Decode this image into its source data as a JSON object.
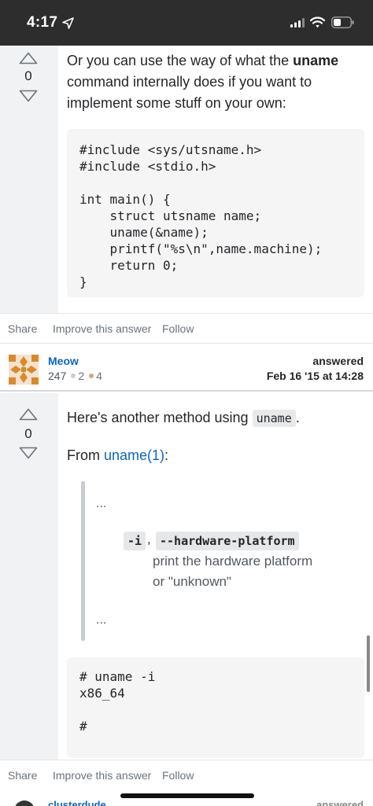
{
  "status_bar": {
    "time": "4:17"
  },
  "answer1": {
    "vote_count": "0",
    "text_before": "Or you can use the way of what the ",
    "text_bold": "uname",
    "text_after": " command internally does if you want to implement some stuff on your own:",
    "code": "#include <sys/utsname.h>\n#include <stdio.h>\n\nint main() {\n    struct utsname name;\n    uname(&name);\n    printf(\"%s\\n\",name.machine);\n    return 0;\n}",
    "actions": {
      "share": "Share",
      "improve": "Improve this answer",
      "follow": "Follow"
    },
    "author": {
      "name": "Meow",
      "reputation": "247",
      "silver_badges": "2",
      "bronze_badges": "4",
      "answered_label": "answered",
      "answered_date": "Feb 16 '15 at 14:28"
    }
  },
  "answer2": {
    "vote_count": "0",
    "intro_text": "Here's another method using ",
    "intro_code": "uname",
    "intro_end": ".",
    "from_text": "From ",
    "from_link": "uname(1)",
    "from_end": ":",
    "quote": {
      "ellipsis_top": "...",
      "flag_short": "-i",
      "flag_sep": ",",
      "flag_long": "--hardware-platform",
      "description_line1": "print the hardware platform",
      "description_line2": "or \"unknown\"",
      "ellipsis_bottom": "..."
    },
    "code": "# uname -i\nx86_64\n\n#",
    "actions": {
      "share": "Share",
      "improve": "Improve this answer",
      "follow": "Follow"
    }
  },
  "next_card": {
    "author_name": "clusterdude",
    "answered_label": "answered"
  },
  "colors": {
    "link": "#0a66c2",
    "silver_badge": "#c7cdd1",
    "bronze_badge": "#d1a684",
    "gutter": "#f1f2f3"
  }
}
